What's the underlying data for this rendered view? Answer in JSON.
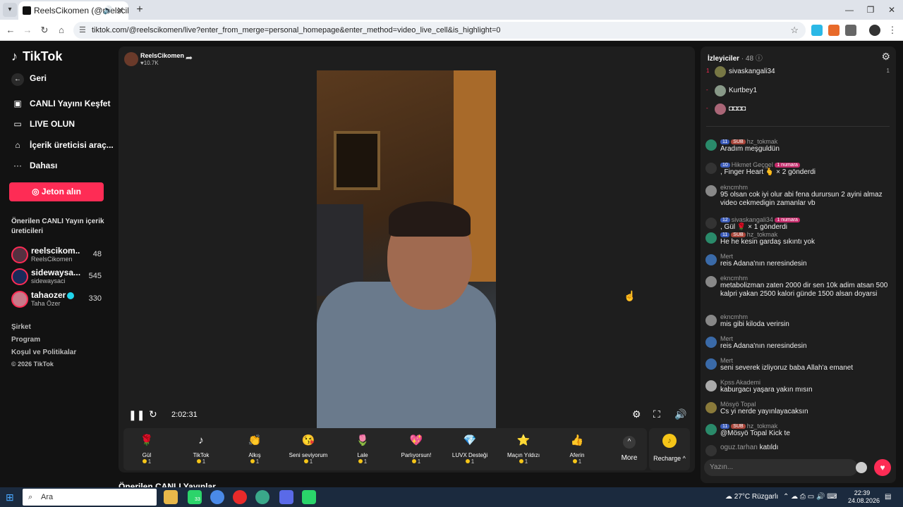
{
  "browser": {
    "tab_title": "ReelsCikomen (@reelsciko",
    "url": "tiktok.com/@reelscikomen/live?enter_from_merge=personal_homepage&enter_method=video_live_cell&is_highlight=0"
  },
  "sidebar": {
    "logo": "TikTok",
    "back": "Geri",
    "nav": [
      {
        "label": "CANLI Yayını Keşfet",
        "icon": "live-tv-icon"
      },
      {
        "label": "LIVE OLUN",
        "icon": "camera-icon"
      },
      {
        "label": "İçerik üreticisi araç...",
        "icon": "creator-tools-icon"
      },
      {
        "label": "Dahası",
        "icon": "more-dots-icon"
      }
    ],
    "jeton_button": "Jeton alın",
    "suggested_title": "Önerilen CANLI Yayın içerik üreticileri",
    "creators": [
      {
        "name": "reelscikom...",
        "sub": "ReelsCikomen",
        "count": "48"
      },
      {
        "name": "sidewaysa...",
        "sub": "sidewaysaci",
        "count": "545"
      },
      {
        "name": "tahaozer",
        "sub": "Taha Özer",
        "count": "330"
      }
    ],
    "footer": [
      "Şirket",
      "Program",
      "Koşul ve Politikalar",
      "© 2026 TikTok"
    ]
  },
  "player": {
    "host_name": "ReelsCikomen",
    "host_likes": "10.7K",
    "timer": "2:02:31",
    "gifts": [
      {
        "name": "Gül",
        "price": "1",
        "icon": "🌹"
      },
      {
        "name": "TikTok",
        "price": "1",
        "icon": "♪"
      },
      {
        "name": "Alkış",
        "price": "1",
        "icon": "👏"
      },
      {
        "name": "Seni seviyorum",
        "price": "1",
        "icon": "😘"
      },
      {
        "name": "Lale",
        "price": "1",
        "icon": "🌷"
      },
      {
        "name": "Parlıyorsun!",
        "price": "1",
        "icon": "💖"
      },
      {
        "name": "LUVX Desteği",
        "price": "1",
        "icon": "💎"
      },
      {
        "name": "Maçın Yıldızı",
        "price": "1",
        "icon": "⭐"
      },
      {
        "name": "Aferin",
        "price": "1",
        "icon": "👍"
      }
    ],
    "more_label": "More",
    "recharge_label": "Recharge ^"
  },
  "below_title": "Önerilen CANLI Yayınlar",
  "chat": {
    "viewers_label": "İzleyiciler",
    "viewers_count": "· 48",
    "top_viewers": [
      {
        "rank": "1",
        "name": "sivaskangali34",
        "right": "1"
      },
      {
        "rank": "-",
        "name": "Kurtbey1",
        "right": ""
      },
      {
        "rank": "-",
        "name": "◘◘◘◘",
        "right": ""
      }
    ],
    "messages": [
      {
        "level": "11",
        "sub": "SUB",
        "user": "hz_tokmak",
        "text": "Aradım meşguldün"
      },
      {
        "level": "10",
        "top": "1 numara",
        "user": "Hikmet Geçgel",
        "text": ", Finger Heart 🫰 × 2 gönderdi"
      },
      {
        "user": "ekncmhm",
        "text": "95 olsan cok iyi olur abi fena durursun 2 ayini almaz video cekmedigin zamanlar vb"
      },
      {
        "level": "12",
        "top": "1 numara",
        "user": "sivaskangali34",
        "text": ", Gül 🌹 × 1 gönderdi"
      },
      {
        "level": "11",
        "sub": "SUB",
        "user": "hz_tokmak",
        "text": "He he kesin gardaş sıkıntı yok"
      },
      {
        "user": "Mert",
        "text": "reis Adana'nın neresindesin"
      },
      {
        "user": "ekncmhm",
        "text": "metabolizman zaten 2000 dir sen 10k adim atsan 500 kalpri yakan 2500 kalori günde 1500 alsan doyarsi"
      },
      {
        "user": "ekncmhm",
        "text": "mis gibi kiloda verirsin"
      },
      {
        "user": "Mert",
        "text": "reis Adana'nın neresindesin"
      },
      {
        "user": "Mert",
        "text": "seni severek izliyoruz baba Allah'a emanet"
      },
      {
        "user": "Kpss Akademi",
        "text": "kaburgacı yaşara yakın mısın"
      },
      {
        "user": "Mösyö Topal",
        "text": "Cs yi nerde yayınlayacaksın"
      },
      {
        "level": "11",
        "sub": "SUB",
        "user": "hz_tokmak",
        "text": "@Mösyö Topal Kick te"
      },
      {
        "user": "oguz.tarhan",
        "text": "katıldı"
      }
    ],
    "input_placeholder": "Yazın..."
  },
  "taskbar": {
    "search": "Ara",
    "whatsapp_badge": "33",
    "weather": "27°C  Rüzgarlı",
    "time": "22:39",
    "date": "24.08.2026"
  }
}
